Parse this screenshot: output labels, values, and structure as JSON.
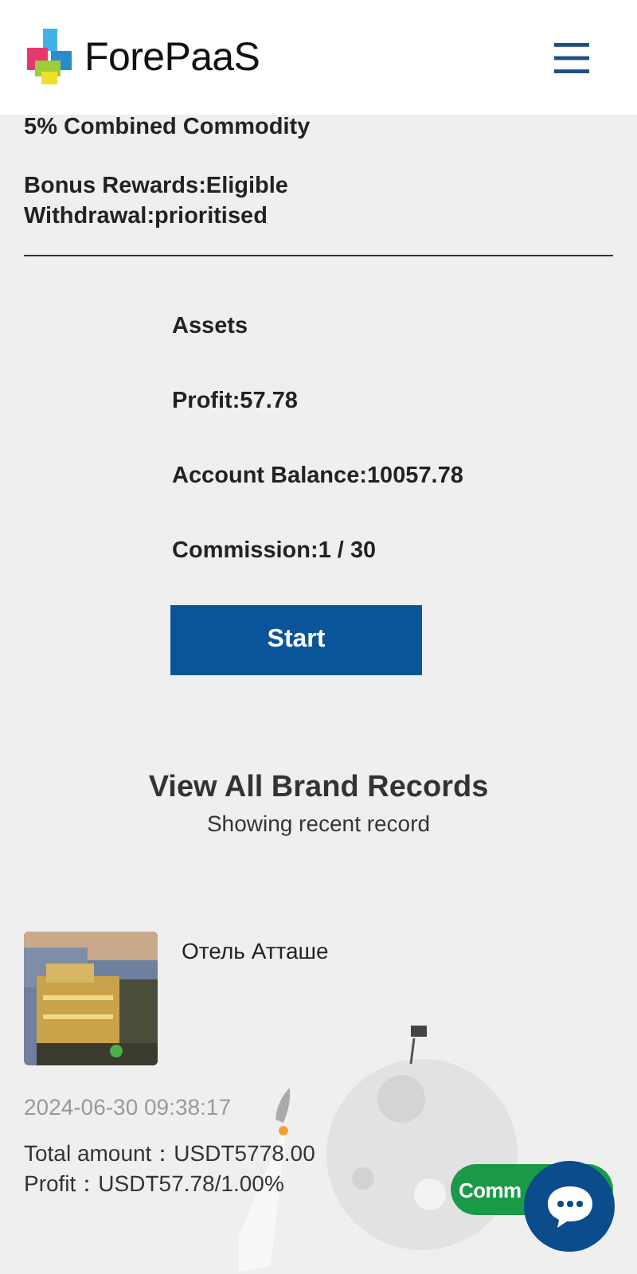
{
  "header": {
    "logo_text": "ForePaaS"
  },
  "plan": {
    "title": "5% Combined Commodity",
    "lines": [
      "Bonus Rewards:Eligible",
      "Withdrawal:prioritised"
    ]
  },
  "stats": [
    "Assets",
    "Profit:57.78",
    "Account Balance:10057.78",
    "Commission:1 / 30"
  ],
  "start_button": "Start",
  "records": {
    "title": "View All Brand Records",
    "subtitle": "Showing recent record"
  },
  "record": {
    "name": "Отель Атташе",
    "time": "2024-06-30 09:38:17",
    "total": "Total amount：USDT5778.00",
    "profit": "Profit：USDT57.78/1.00%",
    "button": "Comm"
  }
}
